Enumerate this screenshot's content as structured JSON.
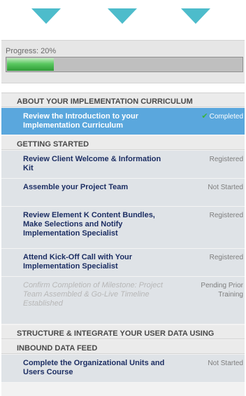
{
  "progress": {
    "label": "Progress:  20%",
    "value": 0.2
  },
  "sections": {
    "about": "ABOUT YOUR IMPLEMENTATION CURRICULUM",
    "getting_started": "GETTING STARTED",
    "structure": "STRUCTURE & INTEGRATE YOUR USER DATA USING",
    "inbound": "INBOUND DATA FEED"
  },
  "items": [
    {
      "title": "Review the Introduction to your Implementation Curriculum",
      "status": "Completed",
      "state": "selected",
      "icon": "checkmark-icon"
    },
    {
      "title": "Review Client Welcome & Information Kit",
      "status": "Registered",
      "state": "normal"
    },
    {
      "title": "Assemble your Project Team",
      "status": "Not Started",
      "state": "normal"
    },
    {
      "title": "Review Element K Content Bundles, Make Selections and Notify Implementation Specialist",
      "status": "Registered",
      "state": "normal"
    },
    {
      "title": "Attend Kick-Off Call with Your Implementation Specialist",
      "status": "Registered",
      "state": "normal"
    },
    {
      "title": "Confirm Completion of Milestone: Project Team Assembled & Go-Live Timeline Established",
      "status": "Pending Prior Training",
      "state": "pending"
    },
    {
      "title": "Complete the Organizational Units and Users Course",
      "status": "Not Started",
      "state": "normal"
    }
  ],
  "colors": {
    "accent": "#4dbccb",
    "selected": "#5aa7dd",
    "title_text": "#1c2e63",
    "progress_green": "#59c85f"
  }
}
